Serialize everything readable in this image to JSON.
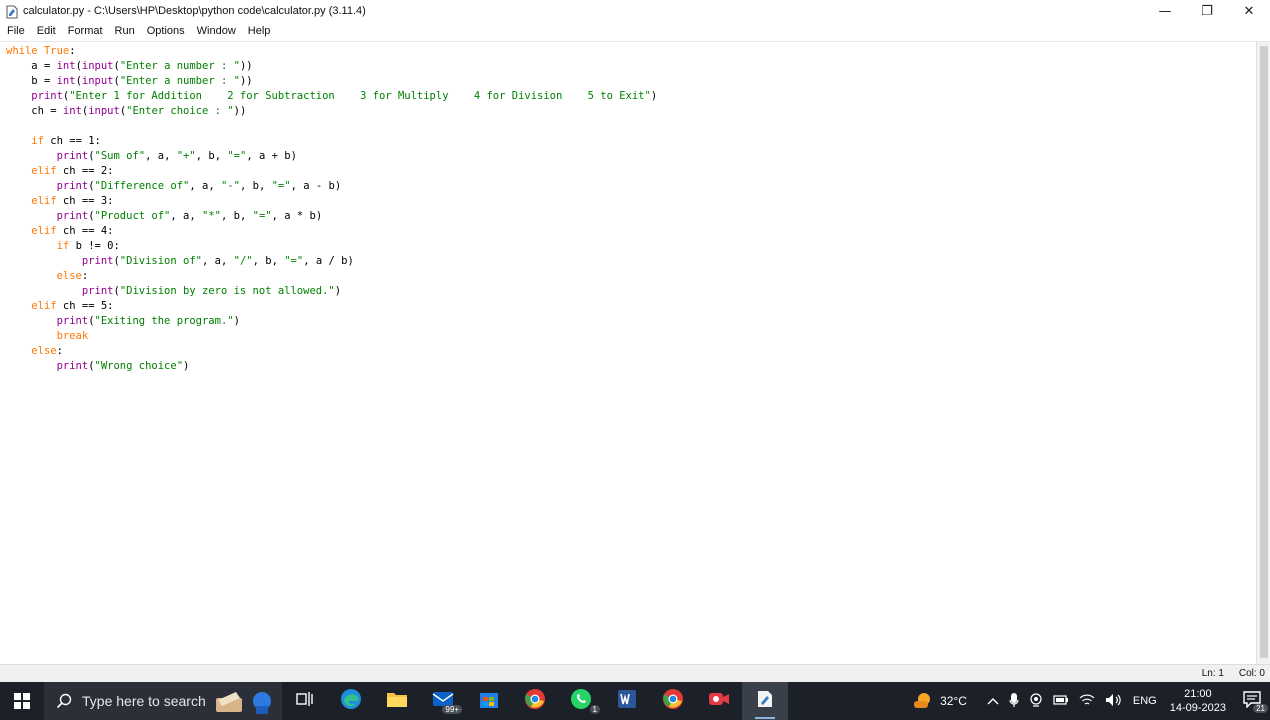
{
  "window": {
    "title": "calculator.py - C:\\Users\\HP\\Desktop\\python code\\calculator.py (3.11.4)",
    "minimize": "—",
    "maximize": "❐",
    "close": "✕"
  },
  "menu": [
    "File",
    "Edit",
    "Format",
    "Run",
    "Options",
    "Window",
    "Help"
  ],
  "code": [
    [
      [
        "kw",
        "while"
      ],
      [
        "",
        ""
      ],
      [
        "",
        ""
      ]
    ],
    [],
    [],
    [],
    [],
    [],
    [],
    [],
    [],
    [],
    [],
    [],
    [],
    [],
    [],
    [],
    [],
    [],
    [],
    [],
    [],
    [],
    []
  ],
  "code_lines": [
    "while True:",
    "    a = int(input(\"Enter a number : \"))",
    "    b = int(input(\"Enter a number : \"))",
    "    print(\"Enter 1 for Addition    2 for Subtraction    3 for Multiply    4 for Division    5 to Exit\")",
    "    ch = int(input(\"Enter choice : \"))",
    "",
    "    if ch == 1:",
    "        print(\"Sum of\", a, \"+\", b, \"=\", a + b)",
    "    elif ch == 2:",
    "        print(\"Difference of\", a, \"-\", b, \"=\", a - b)",
    "    elif ch == 3:",
    "        print(\"Product of\", a, \"*\", b, \"=\", a * b)",
    "    elif ch == 4:",
    "        if b != 0:",
    "            print(\"Division of\", a, \"/\", b, \"=\", a / b)",
    "        else:",
    "            print(\"Division by zero is not allowed.\")",
    "    elif ch == 5:",
    "        print(\"Exiting the program.\")",
    "        break",
    "    else:",
    "        print(\"Wrong choice\")"
  ],
  "status": {
    "ln": "Ln: 1",
    "col": "Col: 0"
  },
  "taskbar": {
    "search_placeholder": "Type here to search",
    "mail_badge": "99+",
    "whatsapp_badge": "1",
    "weather": "32°C",
    "language": "ENG",
    "time": "21:00",
    "date": "14-09-2023",
    "notification_count": "21"
  },
  "colors": {
    "keyword": "#ff7700",
    "builtin": "#900090",
    "string": "#008000",
    "taskbar_bg": "#1c2129"
  }
}
